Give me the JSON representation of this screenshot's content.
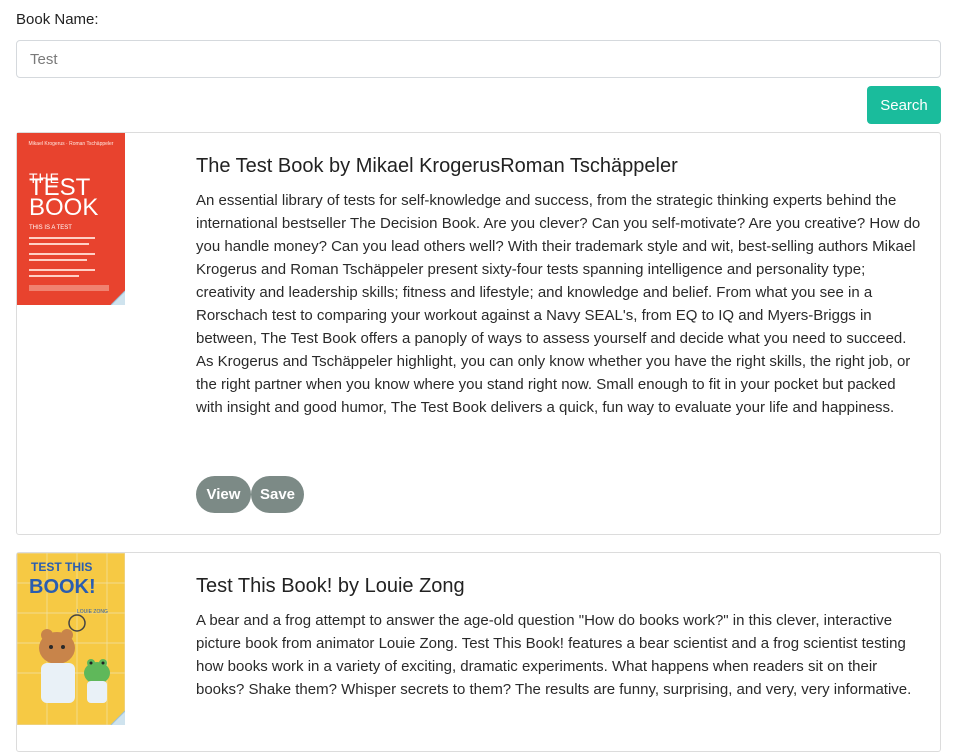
{
  "search": {
    "label": "Book Name:",
    "value": "Test",
    "button_label": "Search"
  },
  "results": [
    {
      "title": "The Test Book by Mikael KrogerusRoman Tschäppeler",
      "description": "An essential library of tests for self-knowledge and success, from the strategic thinking experts behind the international bestseller The Decision Book. Are you clever? Can you self-motivate? Are you creative? How do you handle money? Can you lead others well? With their trademark style and wit, best-selling authors Mikael Krogerus and Roman Tschäppeler present sixty-four tests spanning intelligence and personality type; creativity and leadership skills; fitness and lifestyle; and knowledge and belief. From what you see in a Rorschach test to comparing your workout against a Navy SEAL's, from EQ to IQ and Myers-Briggs in between, The Test Book offers a panoply of ways to assess yourself and decide what you need to succeed. As Krogerus and Tschäppeler highlight, you can only know whether you have the right skills, the right job, or the right partner when you know where you stand right now. Small enough to fit in your pocket but packed with insight and good humor, The Test Book delivers a quick, fun way to evaluate your life and happiness.",
      "view_label": "View",
      "save_label": "Save",
      "cover": {
        "authors": "Mikael Krogerus · Roman Tschäppeler",
        "line1": "THE",
        "line2": "TEST",
        "line3": "BOOK",
        "tagline": "THIS IS A TEST",
        "color": "#e8432e"
      }
    },
    {
      "title": "Test This Book! by Louie Zong",
      "description": "A bear and a frog attempt to answer the age-old question \"How do books work?\" in this clever, interactive picture book from animator Louie Zong. Test This Book! features a bear scientist and a frog scientist testing how books work in a variety of exciting, dramatic experiments. What happens when readers sit on their books? Shake them? Whisper secrets to them? The results are funny, surprising, and very, very informative.",
      "view_label": "View",
      "save_label": "Save",
      "cover": {
        "line1": "TEST THIS",
        "line2": "BOOK!",
        "author": "LOUIE ZONG",
        "color": "#f6c944"
      }
    }
  ]
}
